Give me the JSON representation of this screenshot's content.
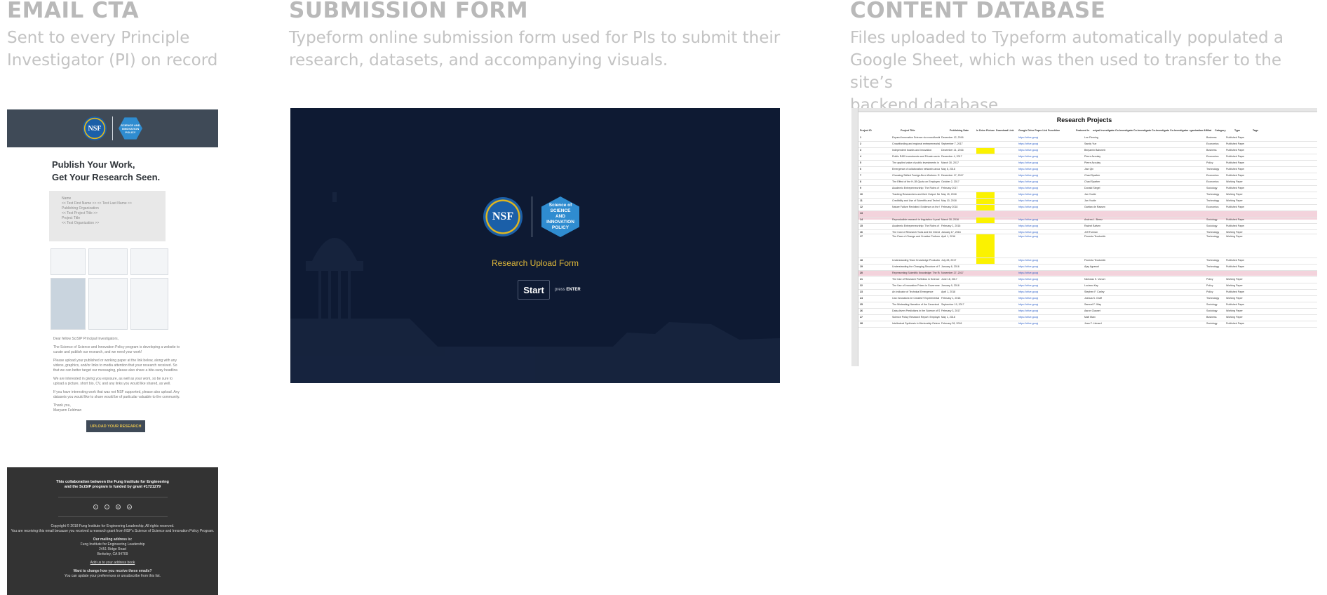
{
  "columns": {
    "email": {
      "heading": "EMAIL CTA",
      "description_line1": "Sent to every Principle",
      "description_line2": "Investigator (PI) on record"
    },
    "form": {
      "heading": "SUBMISSION FORM",
      "description_line1": "Typeform online submission form used for PIs to submit their",
      "description_line2": "research, datasets, and accompanying visuals."
    },
    "database": {
      "heading": "CONTENT DATABASE",
      "description_line1": "Files uploaded to Typeform automatically populated a",
      "description_line2": "Google Sheet, which was then used to transfer to the site’s",
      "description_line3": "backend database."
    }
  },
  "email": {
    "logo_nsf": "NSF",
    "logo_scisip": "SCIENCE AND INNOVATION POLICY",
    "title_line1": "Publish Your Work,",
    "title_line2": "Get Your Research Seen.",
    "merge_fields": [
      "Name",
      "<< Test First Name >> << Test Last Name >>",
      "Publishing Organization",
      "<< Test Project Title >>",
      "Project Title",
      "<< Test Organization >>"
    ],
    "greeting": "Dear fellow SciSIP Principal Investigators,",
    "body": [
      "The Science of Science and Innovation Policy program is developing a website to curate and publish our research, and we need your work!",
      "Please upload your published or working paper at the link below, along with any videos, graphics, and/or links to media attention that your research received. So that we can better target our messaging, please also share a bite-sway headline.",
      "We are interested in giving you exposure, as well as your work, so be sure to upload a picture, short bio, CV, and any links you would like shared, as well.",
      "If you have interesting work that was not NSF supported, please also upload. Any datasets you would like to share would be of particular valuable to the community."
    ],
    "signoff": "Thank you,",
    "signer": "Maryann Feldman",
    "cta_button": "UPLOAD YOUR RESEARCH",
    "footer_line1": "This collaboration between the Fung Institute for Engineering",
    "footer_line2": "and the SciSIP program is funded by grant #1721279",
    "copyright": "Copyright © 2018 Fung Institute for Engineering Leadership, All rights reserved.",
    "copyright2": "You are receiving this email because you received a research grant from NSF's Science of Science and Innovation Policy Program.",
    "mailing_label": "Our mailing address is:",
    "address": [
      "Fung Institute for Engineering Leadership",
      "2451 Ridge Road",
      "Berkeley, CA 94709"
    ],
    "addr_link": "Add us to your address book",
    "change_q": "Want to change how you receive these emails?",
    "change_text": "You can update your preferences or unsubscribe from this list."
  },
  "form": {
    "logo_nsf": "NSF",
    "logo_scisip_l1": "Science of",
    "logo_scisip_l2": "SCIENCE AND",
    "logo_scisip_l3": "INNOVATION",
    "logo_scisip_l4": "POLICY",
    "title": "Research Upload Form",
    "start_button": "Start",
    "press_label": "press",
    "enter_key": "ENTER"
  },
  "sheet": {
    "title": "Research Projects",
    "headers": [
      "Project ID",
      "Project Title",
      "Publishing Date",
      "le Drive Picture",
      "Download Link",
      "Google Drive Paper Link",
      "Punchline",
      "Featured In",
      "ncipal Investigator",
      "Co-Investigator",
      "Co-Investigator",
      "Co-Investigator",
      "Co-Investigator",
      "rganization Affiliat",
      "Category",
      "Type",
      "Tags"
    ],
    "rows": [
      {
        "n": "1",
        "title": "Expand Innovation Science via crowdfunding",
        "date": "December 12, 2016",
        "pi": "Lee Fleming",
        "cat": "Business",
        "type": "Published Paper"
      },
      {
        "n": "2",
        "title": "Crowdfunding and regional entrepreneurial investment: an ap",
        "date": "September 7, 2017",
        "pi": "Sandy Yue",
        "cat": "Economics",
        "type": "Published Paper"
      },
      {
        "n": "3",
        "title": "Independent boards and innovation",
        "date": "December 21, 2016",
        "pi": "Benjamin Balsmeier",
        "cat": "Business",
        "type": "Published Paper"
      },
      {
        "n": "4",
        "title": "Public R&D Investments and Private-sector Patenting: Evide",
        "date": "December 4, 2017",
        "pi": "Pierre Azoulay",
        "cat": "Economics",
        "type": "Published Paper"
      },
      {
        "n": "5",
        "title": "The applied value of public investments in biomedical resear",
        "date": "March 30, 2017",
        "pi": "Pierre Azoulay",
        "cat": "Policy",
        "type": "Published Paper"
      },
      {
        "n": "6",
        "title": "Emergence of collaboration networks around large scale dat",
        "date": "May 8, 2018",
        "pi": "Jian Qin",
        "cat": "Technology",
        "type": "Published Paper"
      },
      {
        "n": "7",
        "title": "Choosing Skilled Foreign-Born Workers: Evaluating Alternati",
        "date": "December 17, 2017",
        "pi": "Chad Sparber",
        "cat": "Economics",
        "type": "Published Paper"
      },
      {
        "n": "8",
        "title": "The Effect of the H-1B Quota on Employment and Selection",
        "date": "October 2, 2017",
        "pi": "Chad Sparber",
        "cat": "Economics",
        "type": "Working Paper"
      },
      {
        "n": "9",
        "title": "Academic Entrepreneurship: The Roles of Identity, Motivation",
        "date": "February 2017",
        "pi": "Donald Siegel",
        "cat": "Sociology",
        "type": "Published Paper"
      },
      {
        "n": "10",
        "title": "Tracking Researchers and their Output: New Insights from O",
        "date": "May 15, 2018",
        "pi": "Jan Youtie",
        "cat": "Technology",
        "type": "Working Paper"
      },
      {
        "n": "11",
        "title": "Credibility and Use of Scientific and Technical Information in",
        "date": "May 10, 2018",
        "pi": "Jan Youtie",
        "cat": "Technology",
        "type": "Working Paper"
      },
      {
        "n": "12",
        "title": "Nature Failure Revisited: Evidence on the Use of Virtual Pate",
        "date": "February 2018",
        "pi": "Gaétan de Rassenfosse",
        "cat": "Economics",
        "type": "Published Paper"
      },
      {
        "n": "13",
        "title": "",
        "date": "",
        "pi": "",
        "cat": "",
        "type": ""
      },
      {
        "n": "14",
        "title": "Reproducible research in linguistics: A position statement on",
        "date": "March 30, 2016",
        "pi": "Andrea L. Berez",
        "cat": "Sociology",
        "type": "Published Paper"
      },
      {
        "n": "15",
        "title": "Academic Entrepreneurship: The Roles of Identity, Motivation",
        "date": "February 1, 2016",
        "pi": "Rachel Balven",
        "cat": "Sociology",
        "type": "Published Paper"
      },
      {
        "n": "16",
        "title": "The Cost of Research Tools and the Direction of Innovation",
        "date": "January 17, 2016",
        "pi": "Jeff Furman",
        "cat": "Technology",
        "type": "Working Paper"
      },
      {
        "n": "17",
        "title": "The Pace of Change and Creative Performance: Specialist a",
        "date": "April 1, 2016",
        "pi": "Florenta Teodoridis",
        "cat": "Technology",
        "type": "Working Paper"
      },
      {
        "n": "18",
        "title": "Understanding Team Knowledge Production: The Interrelate",
        "date": "July 28, 2017",
        "pi": "Florenta Teodoridis",
        "cat": "Technology",
        "type": "Published Paper"
      },
      {
        "n": "19",
        "title": "Understanding the Changing Structure of Scientific Inquiry",
        "date": "January 6, 2016",
        "pi": "Ajay Agrawal",
        "cat": "Technology",
        "type": "Published Paper"
      },
      {
        "n": "20",
        "title": "Representing Scientific Knowledge: The Role of Uncertainty",
        "date": "November 27, 2017",
        "pi": "",
        "cat": "",
        "type": ""
      },
      {
        "n": "21",
        "title": "The Use of Research Portfolios in Science Policy",
        "date": "June 18, 2017",
        "pi": "Nicholas S. Vonortas",
        "cat": "Policy",
        "type": "Working Paper"
      },
      {
        "n": "22",
        "title": "The Use of Innovation Prizes in Government",
        "date": "January 9, 2018",
        "pi": "Luciano Kay",
        "cat": "Policy",
        "type": "Working Paper"
      },
      {
        "n": "23",
        "title": "An Indicator of Technical Emergence",
        "date": "April 1, 2018",
        "pi": "Stephen F. Carley",
        "cat": "Policy",
        "type": "Published Paper"
      },
      {
        "n": "24",
        "title": "Can Innovators be Created? Experimental Evidence from an",
        "date": "February 1, 2018",
        "pi": "Joshua S. Graff",
        "cat": "Technology",
        "type": "Working Paper"
      },
      {
        "n": "25",
        "title": "The Misleading Narrative of the Canonical Faculty Productivity",
        "date": "September 19, 2017",
        "pi": "Samuel F. Way",
        "cat": "Sociology",
        "type": "Published Paper"
      },
      {
        "n": "26",
        "title": "Data-driven Predictions in the Science of Science",
        "date": "February 3, 2017",
        "pi": "Aaron Clauset",
        "cat": "Sociology",
        "type": "Working Paper"
      },
      {
        "n": "27",
        "title": "Science Policy Research Report: Employee Non-compete A",
        "date": "May 1, 2018",
        "pi": "Matt Marx",
        "cat": "Business",
        "type": "Working Paper"
      },
      {
        "n": "28",
        "title": "Intellectual Synthesis in Mentorship Determines Success in A",
        "date": "February 28, 2018",
        "pi": "Jean F. Liénard",
        "cat": "Sociology",
        "type": "Published Paper"
      }
    ]
  }
}
